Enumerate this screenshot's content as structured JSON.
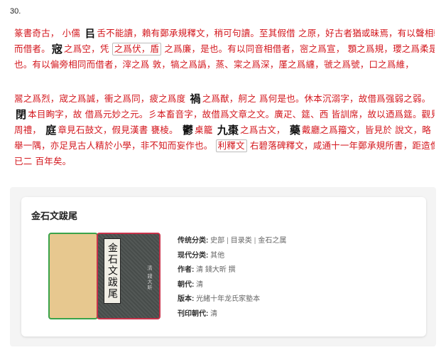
{
  "question_number": "30.",
  "paragraph1": {
    "l1a": "篆書奇古， 小儒 ",
    "l1g": "㠯",
    "l1b": "舌不能讀，賴有鄭承規釋文，稍可句讀。至其假借 之原，好古者猶或昧焉，有以聲相轉",
    "l2a": "而借者。",
    "l2g": "宼",
    "l2b": "之爲空，凭 ",
    "l2box": "之爲伏，盾",
    "l2c": " 之爲廉，是也。有以同音相借者，宻之爲宣， 顋之爲規，瓔之爲柔是",
    "l3": "也。有以偏旁相同而借者，滓之爲 敦，犒之爲譌，蒸、寀之爲深，厪之爲纏，虢之爲號，口之爲維，"
  },
  "paragraph2": {
    "l1a": "翯之爲烈，宬之爲誠，衝之爲同，疲之爲度 ",
    "l1g": "禍",
    "l1b": "之爲猷，舸之 爲何是也。休本沉溺字，故借爲强弱之弱。",
    "l2g": "閉",
    "l2b": "本目眴字，故 借爲元妙之元。彡本畜音字，故借爲文章之文。廣疋、筵、西 皆訓席，故以迺爲筵。觀見",
    "l3a": "周禮， ",
    "l3g1": "庭",
    "l3b": "章見石鼓文，假見漢書 甕棱。 ",
    "l3g2": "鬱",
    "l3c": "桌籠 ",
    "l3g3": "九棗",
    "l3d": "之爲古文， ",
    "l3g4": "藥",
    "l3e": "戴廳之爲籀文，皆見於 說文，略",
    "l4a": "舉一隅，亦足見古人精於小學，非不知而妄作也。 ",
    "l4box": "利釋文",
    "l4b": " 右碧落碑釋文，咸通十一年鄭承規所書，距造像時",
    "l5": "已二 百年矣。"
  },
  "book": {
    "title": "金石文跋尾",
    "cover_label": "金石文跋尾",
    "cover_sub": "清 錢大昕",
    "fields": {
      "category_traditional_key": "传统分类:",
      "category_traditional_values": [
        "史部",
        "目录类",
        "金石之属"
      ],
      "category_modern_key": "现代分类:",
      "category_modern_value": "其他",
      "author_key": "作者:",
      "author_value": "清 錢大昕 撰",
      "dynasty_key": "朝代:",
      "dynasty_value": "清",
      "edition_key": "版本:",
      "edition_value": "光緒十年龙氏家塾本",
      "print_dynasty_key": "刊印朝代:",
      "print_dynasty_value": "清"
    }
  },
  "colors": {
    "text_red": "#d3161c",
    "cover_left": "#e7c88f",
    "cover_right": "#4a4f4d",
    "border_green": "#3aa34a",
    "border_red": "#c8324a"
  }
}
